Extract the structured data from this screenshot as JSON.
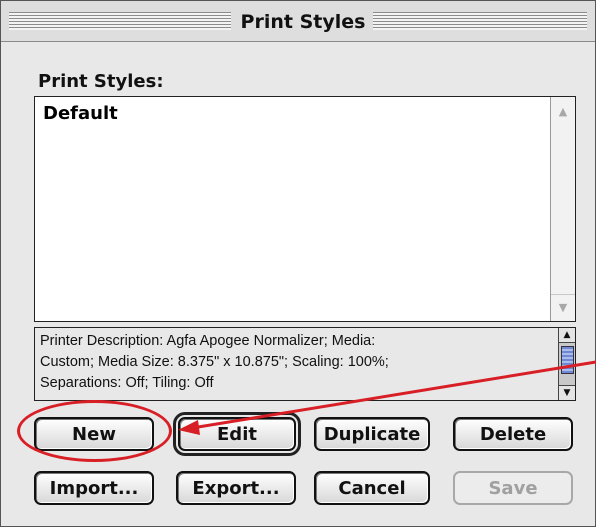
{
  "window": {
    "title": "Print Styles"
  },
  "list": {
    "label": "Print Styles:",
    "items": [
      "Default"
    ]
  },
  "description": {
    "lines": [
      "Printer Description: Agfa Apogee Normalizer;  Media:",
      "Custom;  Media Size: 8.375\" x 10.875\";  Scaling: 100%;",
      "Separations: Off;  Tiling: Off"
    ]
  },
  "buttons": {
    "new": "New",
    "edit": "Edit",
    "duplicate": "Duplicate",
    "delete": "Delete",
    "import": "Import...",
    "export": "Export...",
    "cancel": "Cancel",
    "save": "Save"
  },
  "colors": {
    "annotation": "#d81f26"
  }
}
